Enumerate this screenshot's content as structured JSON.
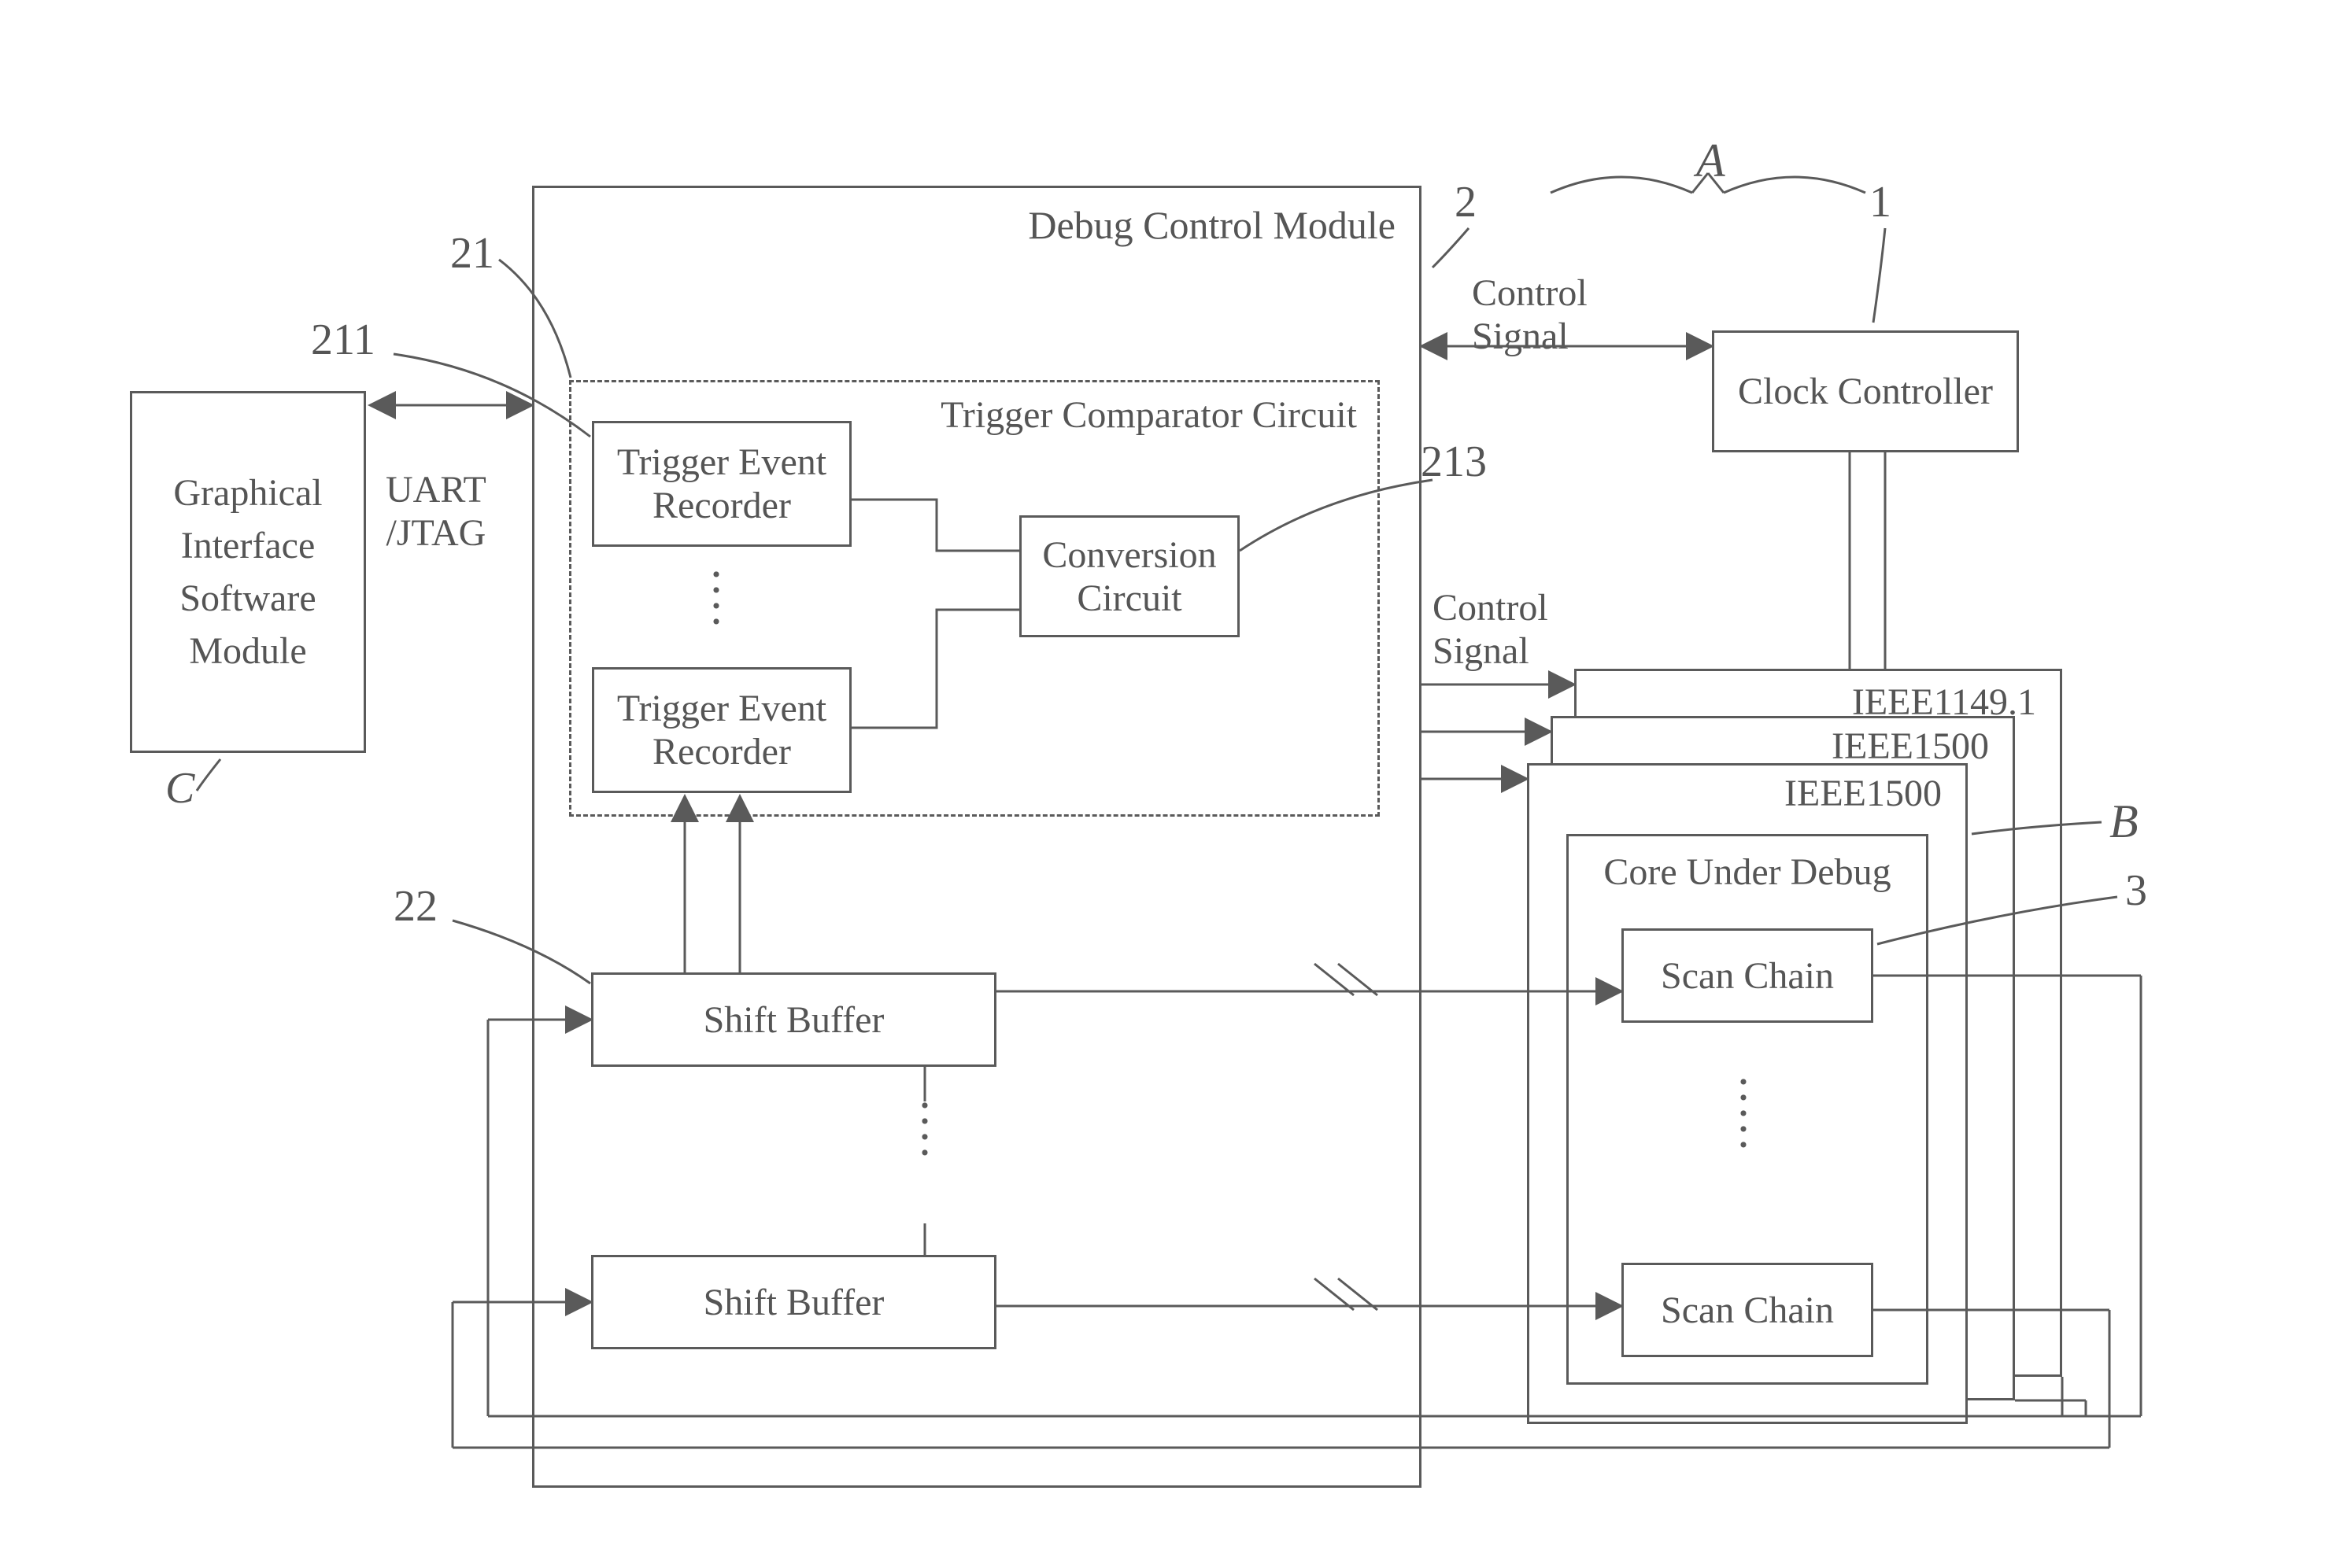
{
  "title": "Debug Control Module Diagram",
  "blocks": {
    "graphical_sw_module": "Graphical\nInterface\nSoftware\nModule",
    "debug_control_module": "Debug Control Module",
    "trigger_comparator_circuit": "Trigger Comparator Circuit",
    "trigger_event_recorder_1": "Trigger Event\nRecorder",
    "trigger_event_recorder_2": "Trigger Event\nRecorder",
    "conversion_circuit": "Conversion\nCircuit",
    "shift_buffer_1": "Shift Buffer",
    "shift_buffer_2": "Shift Buffer",
    "clock_controller": "Clock Controller",
    "ieee_11491": "IEEE1149.1",
    "ieee_1500a": "IEEE1500",
    "ieee_1500b": "IEEE1500",
    "core_under_debug": "Core Under Debug",
    "scan_chain_1": "Scan Chain",
    "scan_chain_2": "Scan Chain"
  },
  "labels": {
    "control_signal_top": "Control\nSignal",
    "control_signal_mid": "Control\nSignal",
    "uart_jtag": "UART\n/JTAG",
    "ref_A": "A",
    "ref_B": "B",
    "ref_C": "C",
    "ref_1": "1",
    "ref_2": "2",
    "ref_3": "3",
    "ref_21": "21",
    "ref_22": "22",
    "ref_211": "211",
    "ref_213": "213"
  }
}
